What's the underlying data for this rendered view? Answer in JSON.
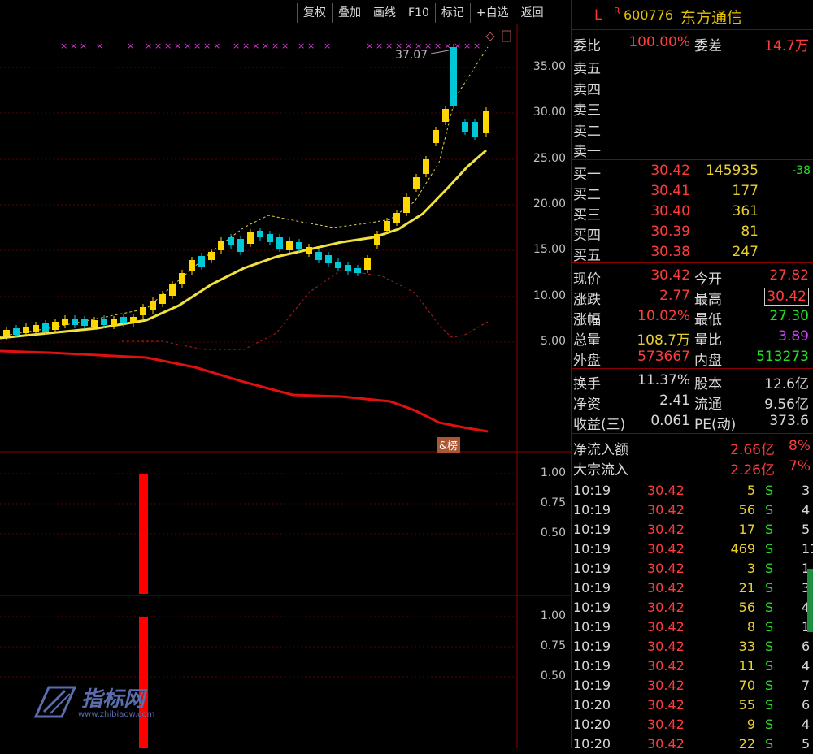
{
  "toolbar": {
    "buttons": [
      "复权",
      "叠加",
      "画线",
      "F10",
      "标记",
      "+自选",
      "返回"
    ]
  },
  "chart": {
    "price_ticks": [
      "35.00",
      "30.00",
      "25.00",
      "20.00",
      "15.00",
      "10.00",
      "5.00"
    ],
    "peak_label": "37.07",
    "badge": "&榜",
    "sub1_ticks": [
      "1.00",
      "0.75",
      "0.50"
    ],
    "sub2_ticks": [
      "1.00",
      "0.75",
      "0.50"
    ],
    "marker_symbol": "×",
    "colors": {
      "up": "#ffd700",
      "down": "#00c8d8",
      "ma": "#f0e040",
      "red_line": "#e01010",
      "bar": "#ff0000"
    }
  },
  "logo": {
    "text": "指标网",
    "url": "www.zhibiaow.com"
  },
  "header": {
    "market": "L",
    "tag": "R",
    "code": "600776",
    "name": "东方通信"
  },
  "order": {
    "weibi_label": "委比",
    "weibi": "100.00%",
    "weicha_label": "委差",
    "weicha": "14.7万"
  },
  "sells": [
    {
      "label": "卖五"
    },
    {
      "label": "卖四"
    },
    {
      "label": "卖三"
    },
    {
      "label": "卖二"
    },
    {
      "label": "卖一"
    }
  ],
  "buys": [
    {
      "label": "买一",
      "price": "30.42",
      "vol": "145935",
      "chg": "-38"
    },
    {
      "label": "买二",
      "price": "30.41",
      "vol": "177",
      "chg": ""
    },
    {
      "label": "买三",
      "price": "30.40",
      "vol": "361",
      "chg": ""
    },
    {
      "label": "买四",
      "price": "30.39",
      "vol": "81",
      "chg": ""
    },
    {
      "label": "买五",
      "price": "30.38",
      "vol": "247",
      "chg": ""
    }
  ],
  "quote": {
    "xj_l": "现价",
    "xj": "30.42",
    "jk_l": "今开",
    "jk": "27.82",
    "zd_l": "涨跌",
    "zd": "2.77",
    "zg_l": "最高",
    "zg": "30.42",
    "zf_l": "涨幅",
    "zf": "10.02%",
    "zd2_l": "最低",
    "zd2": "27.30",
    "zl_l": "总量",
    "zl": "108.7万",
    "lb_l": "量比",
    "lb": "3.89",
    "wp_l": "外盘",
    "wp": "573667",
    "np_l": "内盘",
    "np": "513273"
  },
  "fund": {
    "hs_l": "换手",
    "hs": "11.37%",
    "gb_l": "股本",
    "gb": "12.6亿",
    "jz_l": "净资",
    "jz": "2.41",
    "lt_l": "流通",
    "lt": "9.56亿",
    "sy_l": "收益(三)",
    "sy": "0.061",
    "pe_l": "PE(动)",
    "pe": "373.6"
  },
  "flow": {
    "net_l": "净流入额",
    "net": "2.66亿",
    "net_pct": "8%",
    "big_l": "大宗流入",
    "big": "2.26亿",
    "big_pct": "7%"
  },
  "ticks": [
    {
      "time": "10:19",
      "price": "30.42",
      "vol": "5",
      "side": "S",
      "n": "3"
    },
    {
      "time": "10:19",
      "price": "30.42",
      "vol": "56",
      "side": "S",
      "n": "4"
    },
    {
      "time": "10:19",
      "price": "30.42",
      "vol": "17",
      "side": "S",
      "n": "5"
    },
    {
      "time": "10:19",
      "price": "30.42",
      "vol": "469",
      "side": "S",
      "n": "11"
    },
    {
      "time": "10:19",
      "price": "30.42",
      "vol": "3",
      "side": "S",
      "n": "1"
    },
    {
      "time": "10:19",
      "price": "30.42",
      "vol": "21",
      "side": "S",
      "n": "3"
    },
    {
      "time": "10:19",
      "price": "30.42",
      "vol": "56",
      "side": "S",
      "n": "4"
    },
    {
      "time": "10:19",
      "price": "30.42",
      "vol": "8",
      "side": "S",
      "n": "1"
    },
    {
      "time": "10:19",
      "price": "30.42",
      "vol": "33",
      "side": "S",
      "n": "6"
    },
    {
      "time": "10:19",
      "price": "30.42",
      "vol": "11",
      "side": "S",
      "n": "4"
    },
    {
      "time": "10:19",
      "price": "30.42",
      "vol": "70",
      "side": "S",
      "n": "7"
    },
    {
      "time": "10:20",
      "price": "30.42",
      "vol": "55",
      "side": "S",
      "n": "6"
    },
    {
      "time": "10:20",
      "price": "30.42",
      "vol": "9",
      "side": "S",
      "n": "4"
    },
    {
      "time": "10:20",
      "price": "30.42",
      "vol": "22",
      "side": "S",
      "n": "5"
    }
  ]
}
